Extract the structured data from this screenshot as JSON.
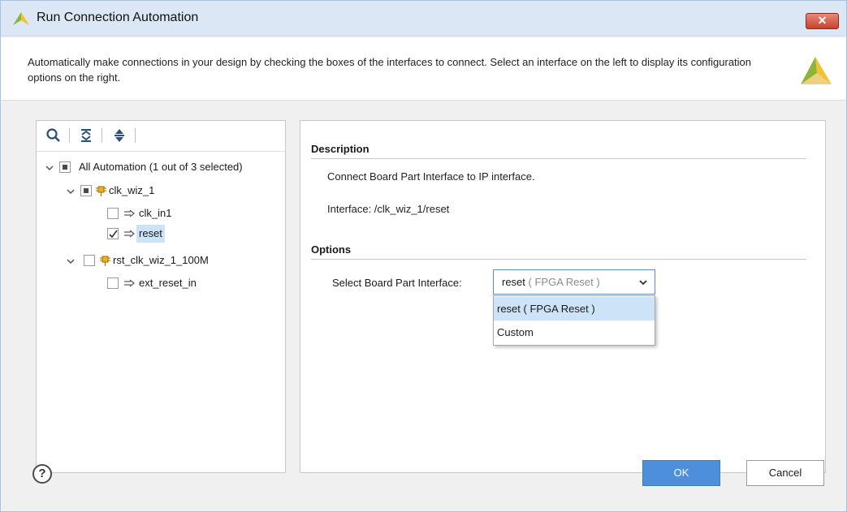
{
  "window": {
    "title": "Run Connection Automation",
    "close_label": "✕"
  },
  "banner": {
    "description": "Automatically make connections in your design by checking the boxes of the interfaces to connect. Select an interface on the left to display its configuration options on the right."
  },
  "tree": {
    "toolbar_icons": [
      "search-icon",
      "collapse-all-icon",
      "expand-all-icon"
    ],
    "root": {
      "label": "All Automation (1 out of 3 selected)",
      "state": "partial",
      "expanded": true
    },
    "items": [
      {
        "label": "clk_wiz_1",
        "state": "partial",
        "expanded": true,
        "type": "ip"
      },
      {
        "label": "clk_in1",
        "state": "unchecked",
        "type": "interface"
      },
      {
        "label": "reset",
        "state": "checked",
        "type": "interface",
        "selected": true
      },
      {
        "label": "rst_clk_wiz_1_100M",
        "state": "unchecked",
        "expanded": true,
        "type": "ip"
      },
      {
        "label": "ext_reset_in",
        "state": "unchecked",
        "type": "interface"
      }
    ]
  },
  "details": {
    "description_title": "Description",
    "description_text": "Connect Board Part Interface to IP interface.",
    "interface_text": "Interface: /clk_wiz_1/reset",
    "options_title": "Options",
    "select_label": "Select Board Part Interface:",
    "select_value": "reset",
    "select_value_sub": "( FPGA Reset )",
    "dropdown_options": [
      {
        "label": "reset ( FPGA Reset )",
        "highlighted": true
      },
      {
        "label": "Custom",
        "highlighted": false
      }
    ]
  },
  "footer": {
    "help_label": "?",
    "ok_label": "OK",
    "cancel_label": "Cancel"
  },
  "colors": {
    "accent": "#4d8fda",
    "selection": "#cde3f7",
    "titlebar": "#dbe7f4",
    "close": "#c6432f",
    "logo_yellow": "#f2c230",
    "logo_green": "#8cb43a"
  }
}
